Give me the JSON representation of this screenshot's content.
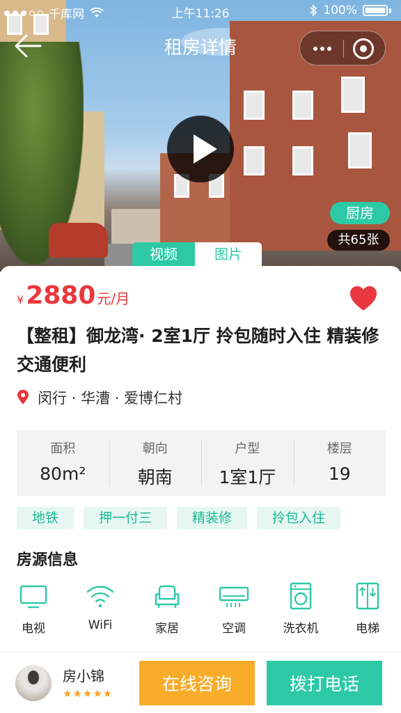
{
  "status_bar": {
    "carrier": "千库网",
    "time": "上午11:26",
    "battery": "100%"
  },
  "nav": {
    "title": "租房详情"
  },
  "media": {
    "photo_tag": "厨房",
    "photo_count": "共65张",
    "tabs": [
      {
        "label": "视频"
      },
      {
        "label": "图片"
      }
    ]
  },
  "listing": {
    "price_symbol": "¥",
    "price": "2880",
    "price_unit": "元/月",
    "title": "【整租】御龙湾· 2室1厅 拎包随时入住 精装修 交通便利",
    "location": "闵行 · 华漕 · 爱博仁村",
    "stats": [
      {
        "label": "面积",
        "value": "80m²"
      },
      {
        "label": "朝向",
        "value": "朝南"
      },
      {
        "label": "户型",
        "value": "1室1厅"
      },
      {
        "label": "楼层",
        "value": "19"
      }
    ],
    "tags": [
      "地铁",
      "押一付三",
      "精装修",
      "拎包入住"
    ]
  },
  "amenities": {
    "title": "房源信息",
    "items": [
      {
        "label": "电视",
        "icon": "tv-icon"
      },
      {
        "label": "WiFi",
        "icon": "wifi-icon"
      },
      {
        "label": "家居",
        "icon": "sofa-icon"
      },
      {
        "label": "空调",
        "icon": "air-conditioner-icon"
      },
      {
        "label": "洗衣机",
        "icon": "washing-machine-icon"
      },
      {
        "label": "电梯",
        "icon": "elevator-icon"
      }
    ]
  },
  "agent": {
    "name": "房小锦",
    "rating_stars": "★★★★★"
  },
  "actions": {
    "consult": "在线咨询",
    "call": "拨打电话"
  },
  "colors": {
    "accent": "#2dc9a7",
    "price": "#e8383d",
    "consult": "#f8ac2a",
    "heart": "#e8383d"
  }
}
